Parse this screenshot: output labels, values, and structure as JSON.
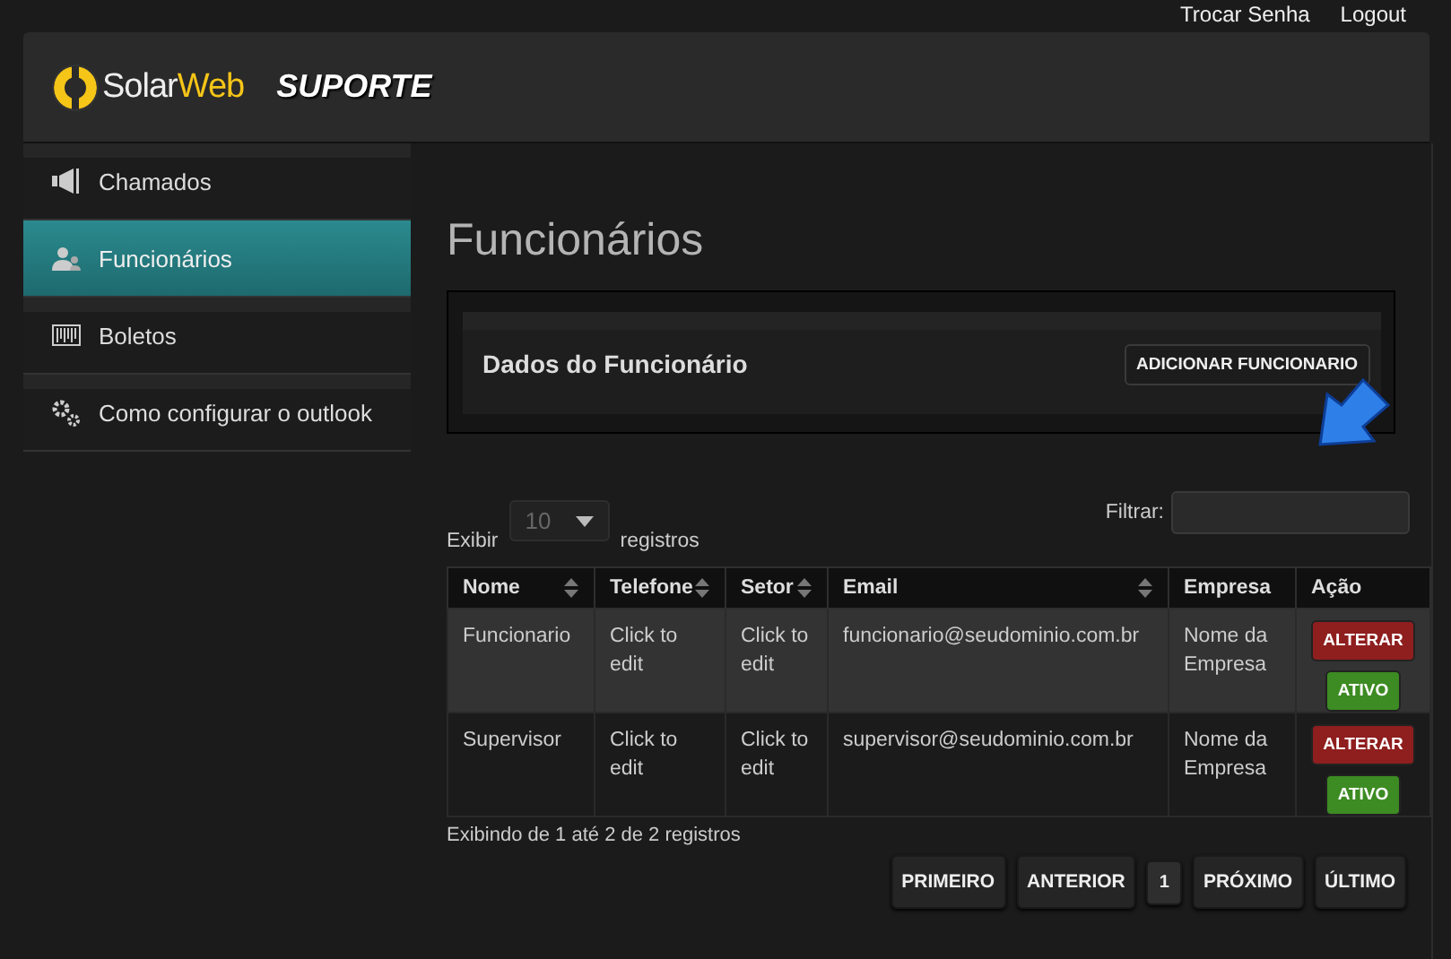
{
  "top_links": [
    "Trocar Senha",
    "Logout"
  ],
  "header": {
    "logo": {
      "name": "Solar",
      "accent": "Web"
    },
    "title": "SUPORTE"
  },
  "sidebar": {
    "items": [
      {
        "label": "Chamados",
        "selected": false
      },
      {
        "label": "Funcionários",
        "selected": true
      },
      {
        "label": "Boletos",
        "selected": false
      },
      {
        "label": "Como configurar o outlook",
        "selected": false
      }
    ]
  },
  "page_title": "Funcionários",
  "panel": {
    "title": "Dados do Funcionário",
    "button": "ADICIONAR FUNCIONARIO"
  },
  "table_controls": {
    "show_label": "Exibir",
    "page_size": "10",
    "records_label": "registros",
    "filter_label": "Filtrar:"
  },
  "table": {
    "columns": [
      {
        "label": "Nome",
        "sortable": true
      },
      {
        "label": "Telefone",
        "sortable": true
      },
      {
        "label": "Setor",
        "sortable": true
      },
      {
        "label": "Email",
        "sortable": true
      },
      {
        "label": "Empresa",
        "sortable": false
      },
      {
        "label": "Ação",
        "sortable": false
      }
    ],
    "rows": [
      {
        "highlighted": true,
        "cells": [
          "Funcionario",
          "Click to edit",
          "Click to edit",
          "funcionario@seudominio.com.br",
          "Nome da Empresa"
        ],
        "edit": "ALTERAR",
        "status": "ATIVO"
      },
      {
        "highlighted": false,
        "cells": [
          "Supervisor",
          "Click to edit",
          "Click to edit",
          "supervisor@seudominio.com.br",
          "Nome da Empresa"
        ],
        "edit": "ALTERAR",
        "status": "ATIVO"
      }
    ]
  },
  "info": "Exibindo de 1 até 2 de 2 registros",
  "pagination": [
    {
      "label": "PRIMEIRO",
      "selected": false
    },
    {
      "label": "ANTERIOR",
      "selected": false
    },
    {
      "label": "1",
      "selected": true
    },
    {
      "label": "PRÓXIMO",
      "selected": false
    },
    {
      "label": "ÚLTIMO",
      "selected": false
    }
  ]
}
